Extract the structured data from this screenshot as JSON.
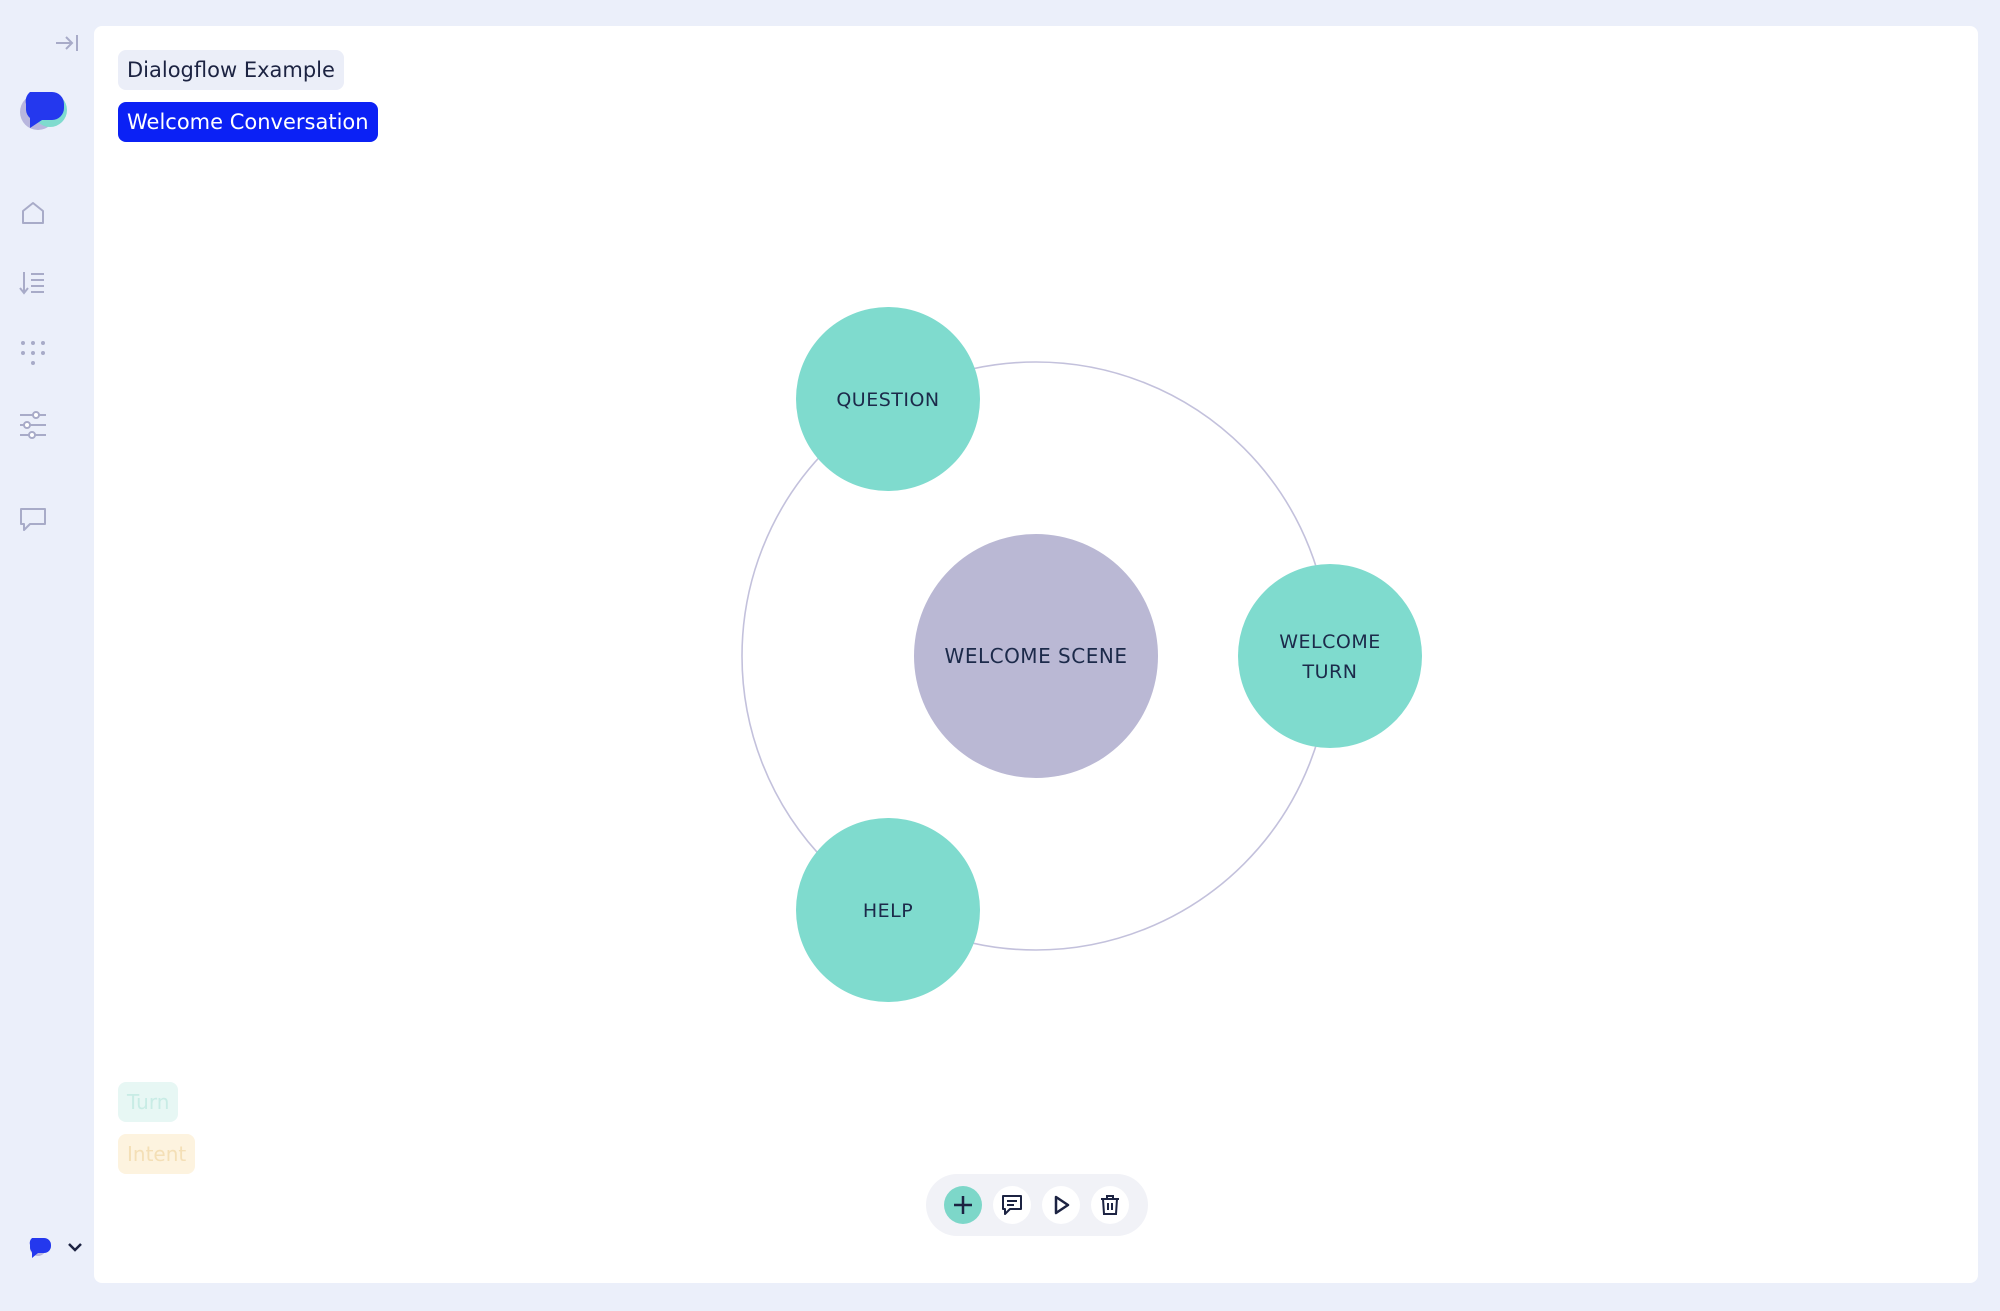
{
  "sidebar": {
    "icons": [
      "collapse-icon",
      "logo-icon",
      "home-icon",
      "sort-list-icon",
      "grid-dots-icon",
      "sliders-icon",
      "chat-icon",
      "user-avatar-icon",
      "chevron-down-icon"
    ]
  },
  "breadcrumb": {
    "scenario": "Dialogflow Example",
    "conversation": "Welcome Conversation"
  },
  "graph": {
    "center": {
      "label": "WELCOME SCENE",
      "color": "#bab8d4"
    },
    "nodes": [
      {
        "lines": [
          "QUESTION"
        ],
        "color": "#7fdbce"
      },
      {
        "lines": [
          "WELCOME",
          "TURN"
        ],
        "color": "#7fdbce"
      },
      {
        "lines": [
          "HELP"
        ],
        "color": "#7fdbce"
      }
    ],
    "ring_color": "#c3c1dc",
    "text_color": "#1c2a4a"
  },
  "legend": {
    "turn": "Turn",
    "intent": "Intent"
  },
  "toolbar": {
    "icons": [
      "add-icon",
      "message-icon",
      "play-icon",
      "trash-icon"
    ]
  },
  "colors": {
    "accent": "#0b21f5",
    "turn": "#7fdbce",
    "scene": "#bab8d4",
    "background": "#ebeffa"
  }
}
